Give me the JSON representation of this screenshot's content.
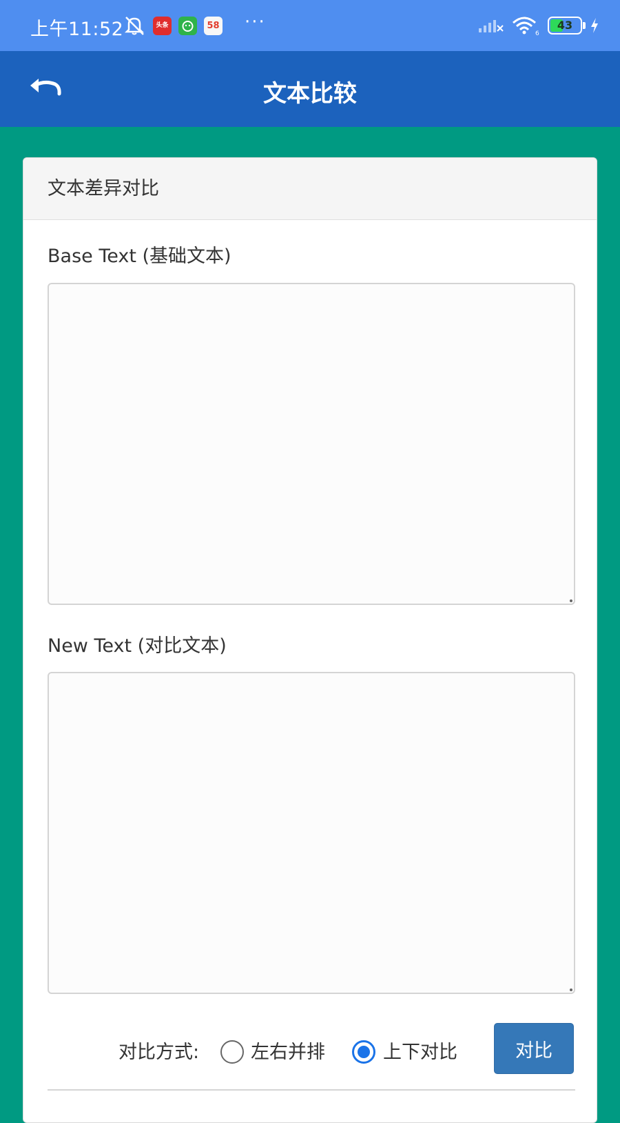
{
  "status_bar": {
    "time": "上午11:52",
    "notifications": [
      {
        "icon": "bell-off-icon"
      },
      {
        "icon": "toutiao-app-icon",
        "label": "头条"
      },
      {
        "icon": "cat-app-icon"
      },
      {
        "icon": "app-58-icon",
        "label": "58"
      }
    ],
    "more": "···",
    "battery_level": "43",
    "battery_fraction": 0.43
  },
  "app_bar": {
    "title": "文本比较",
    "back_icon": "undo-arrow-icon"
  },
  "card": {
    "header": "文本差异对比",
    "base_text": {
      "label": "Base Text (基础文本)",
      "value": ""
    },
    "new_text": {
      "label": "New Text (对比文本)",
      "value": ""
    },
    "compare_mode": {
      "label": "对比方式:",
      "options": [
        {
          "label": "左右并排",
          "checked": false
        },
        {
          "label": "上下对比",
          "checked": true
        }
      ]
    },
    "compare_button": "对比"
  },
  "colors": {
    "status_bar": "#4f8ef0",
    "app_bar": "#1c62bd",
    "background": "#009a82",
    "button": "#3578b8",
    "radio_accent": "#1a73e8"
  }
}
